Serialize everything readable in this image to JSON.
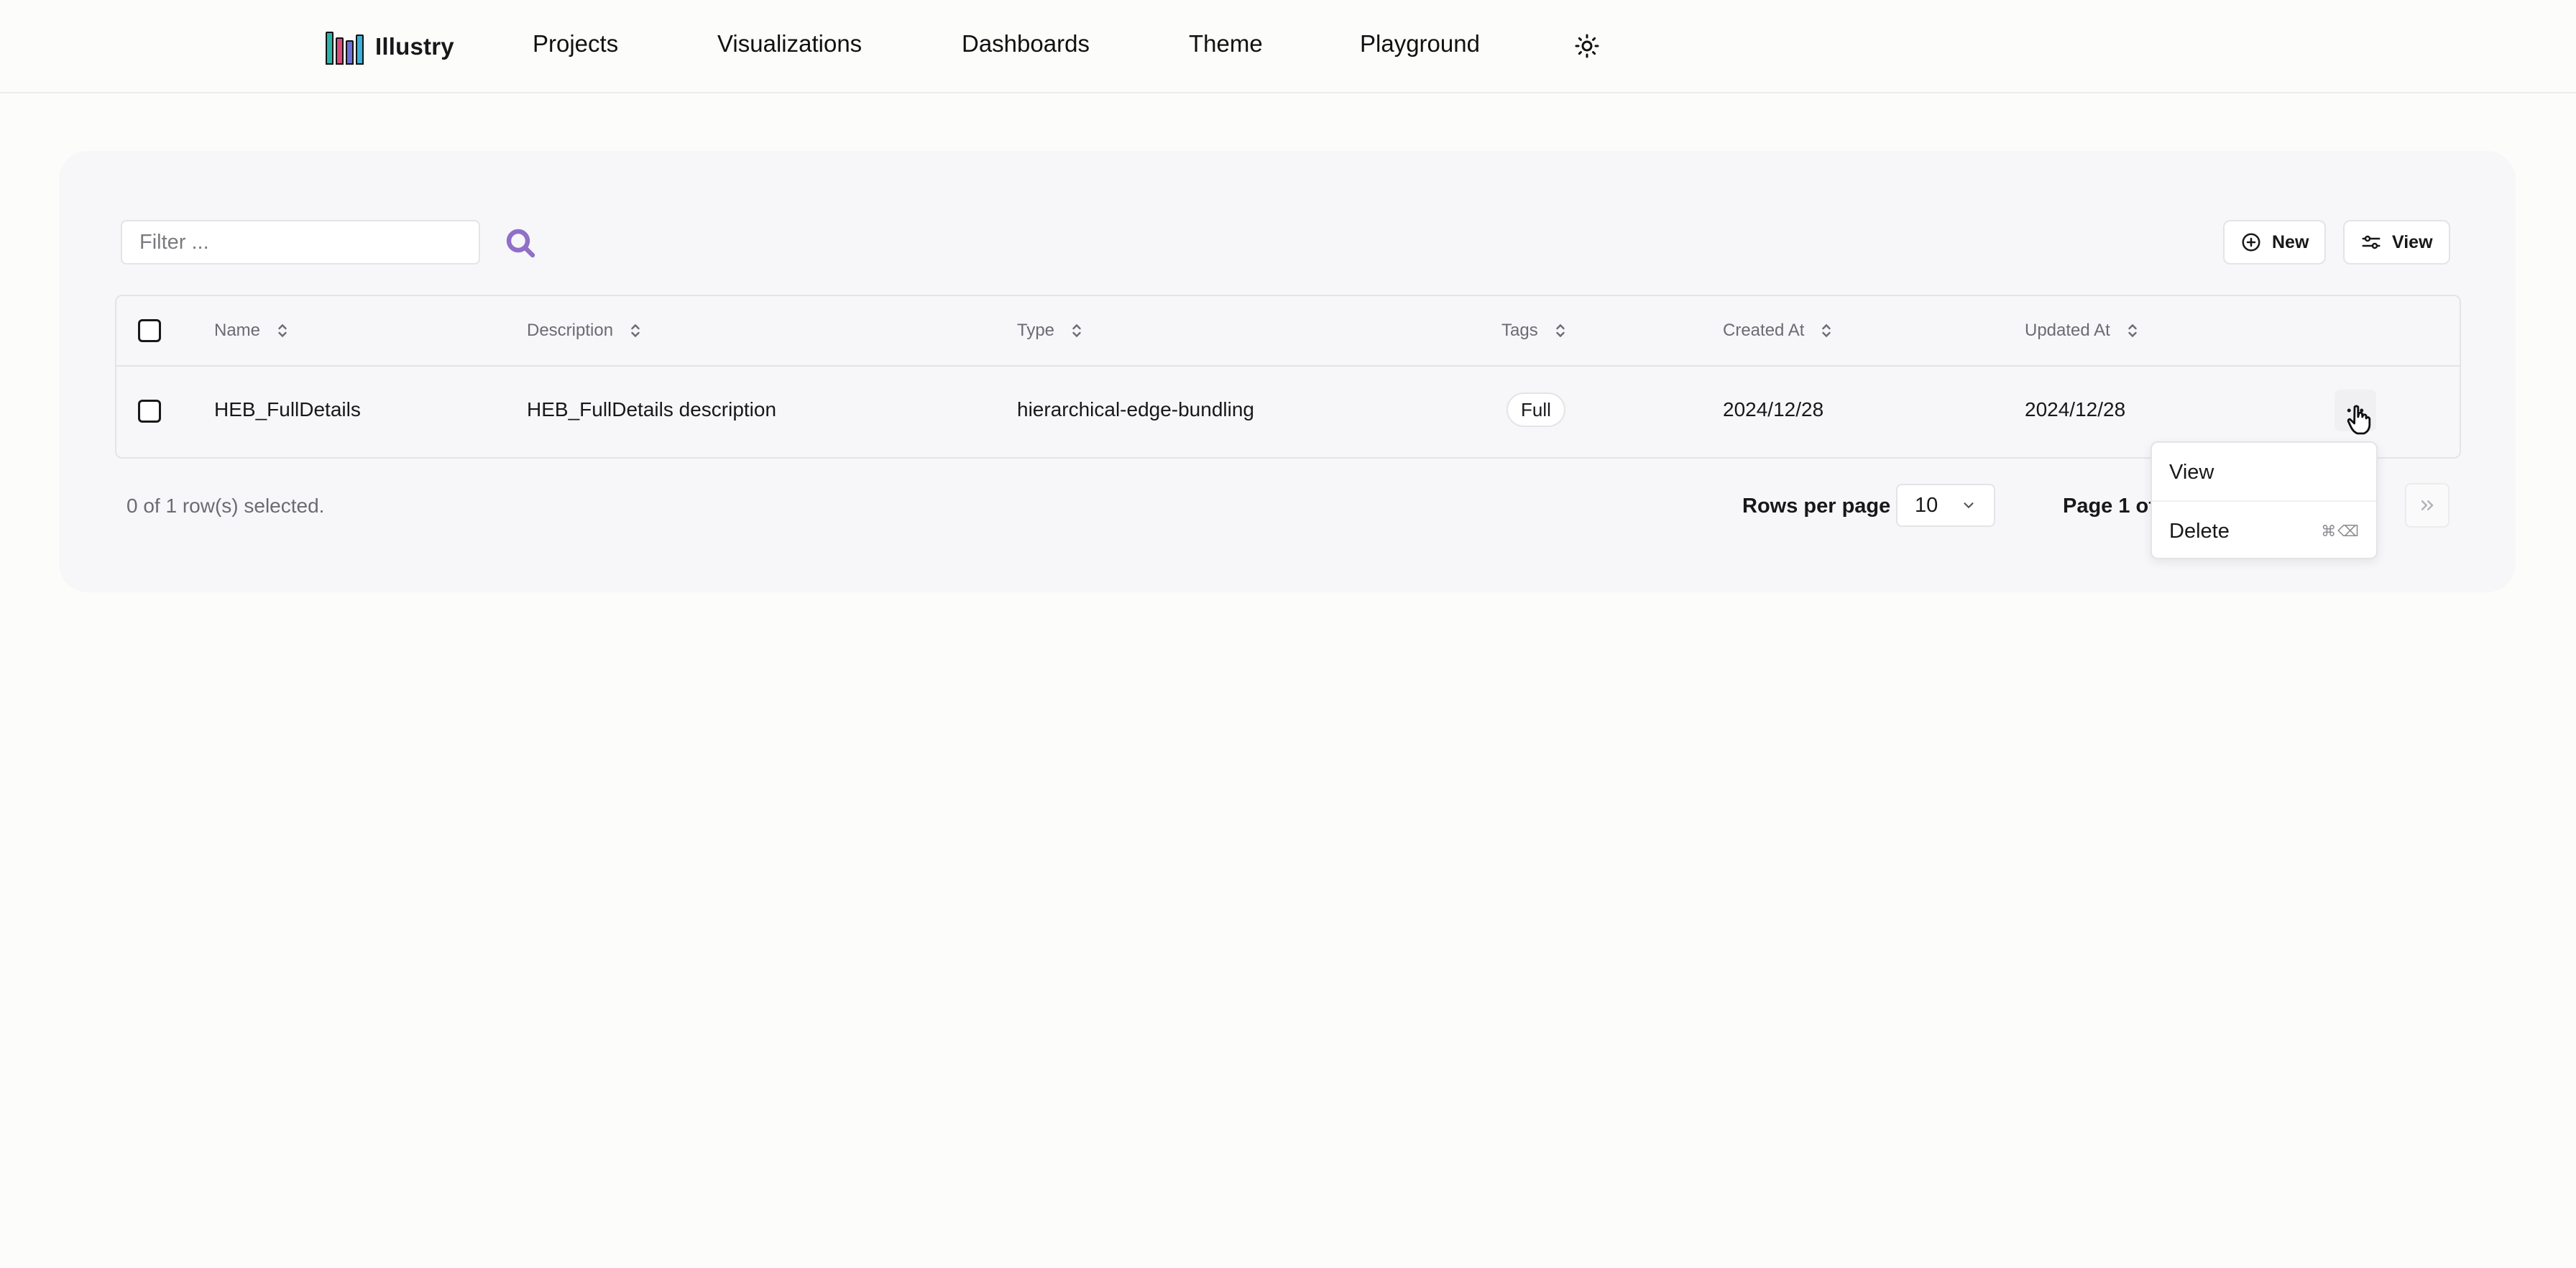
{
  "nav": {
    "brand": "Illustry",
    "links": [
      "Projects",
      "Visualizations",
      "Dashboards",
      "Theme",
      "Playground"
    ],
    "theme_toggle_icon": "sun-icon"
  },
  "toolbar": {
    "filter_placeholder": "Filter ...",
    "search_icon": "search-icon",
    "new_label": "New",
    "view_label": "View"
  },
  "table": {
    "columns": [
      "Name",
      "Description",
      "Type",
      "Tags",
      "Created At",
      "Updated At"
    ],
    "rows": [
      {
        "name": "HEB_FullDetails",
        "description": "HEB_FullDetails description",
        "type": "hierarchical-edge-bundling",
        "tag": "Full",
        "created_at": "2024/12/28",
        "updated_at": "2024/12/28"
      }
    ]
  },
  "footer": {
    "selected_text": "0 of 1 row(s) selected.",
    "rows_per_page_label": "Rows per page",
    "rows_per_page_value": "10",
    "page_info": "Page 1 of"
  },
  "row_menu": {
    "view_label": "View",
    "delete_label": "Delete",
    "delete_shortcut": "⌘⌫"
  },
  "colors": {
    "logo_bars": [
      "#2bb5a8",
      "#d94b7b",
      "#6b6fd6",
      "#3bb0d9"
    ],
    "search_icon": "#8f6fc8"
  }
}
